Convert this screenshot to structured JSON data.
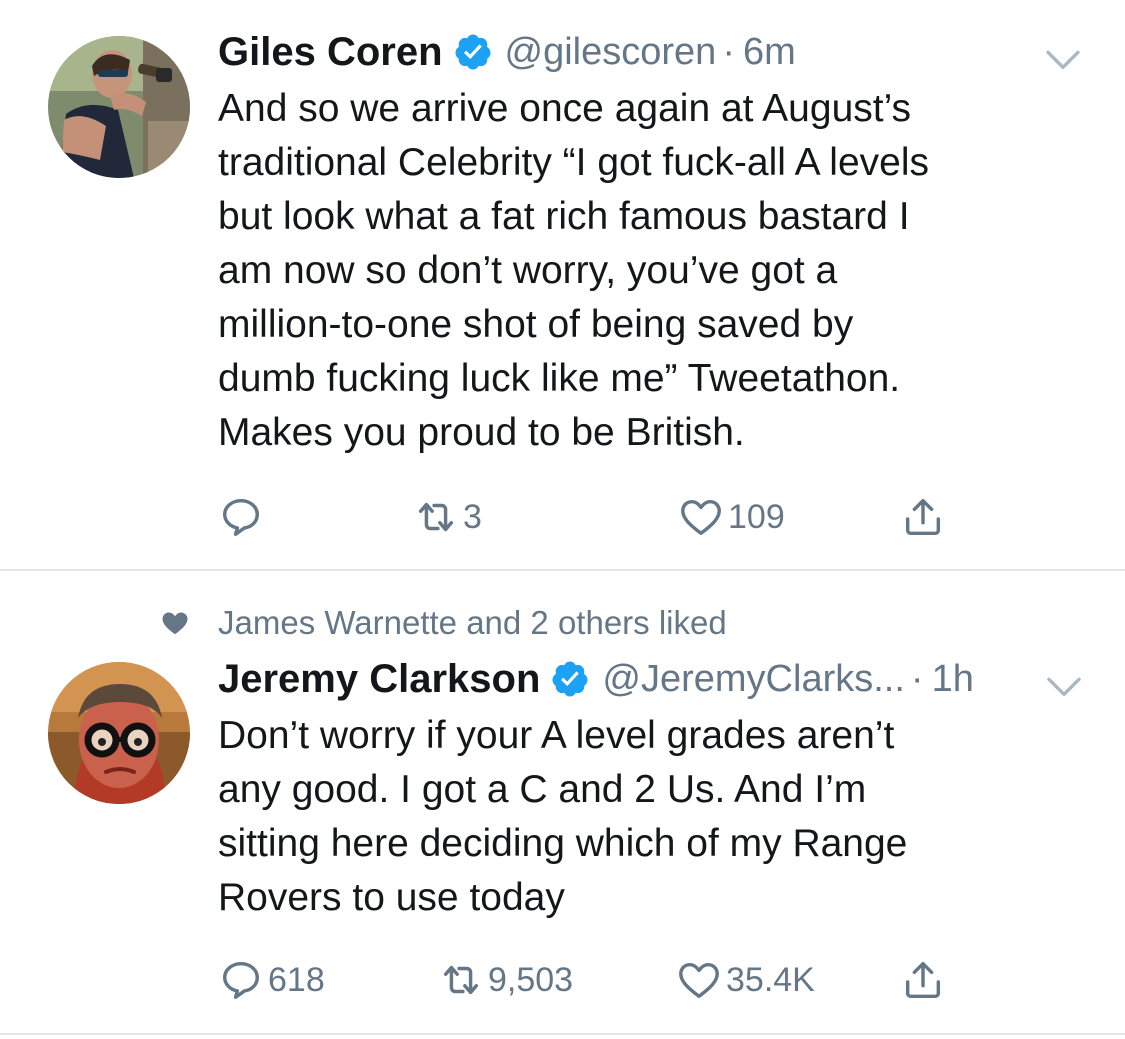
{
  "tweets": [
    {
      "display_name": "Giles Coren",
      "handle": "@gilescoren",
      "separator": "·",
      "time": "6m",
      "verified": true,
      "text_lines": [
        "And so we arrive once again at August’s",
        "traditional Celebrity “I got fuck-all A levels",
        "but look what a fat rich famous bastard I",
        "am now so don’t worry, you’ve got a",
        "million-to-one shot of being saved by",
        "dumb fucking luck like me” Tweetathon.",
        "Makes you proud to be British."
      ],
      "reply_count": "",
      "retweet_count": "3",
      "like_count": "109"
    },
    {
      "social_context": "James Warnette and 2 others liked",
      "display_name": "Jeremy Clarkson",
      "handle": "@JeremyClarks...",
      "separator": "·",
      "time": "1h",
      "verified": true,
      "text_lines": [
        "Don’t worry if your A level grades aren’t",
        "any good. I got a C and 2 Us. And I’m",
        "sitting here deciding which of my Range",
        "Rovers to use today"
      ],
      "reply_count": "618",
      "retweet_count": "9,503",
      "like_count": "35.4K"
    }
  ],
  "icons": {
    "verified": "verified-badge-icon",
    "caret": "chevron-down-icon",
    "reply": "reply-icon",
    "retweet": "retweet-icon",
    "like": "heart-icon",
    "share": "share-icon",
    "liked_context": "heart-filled-icon"
  },
  "colors": {
    "text": "#14171a",
    "secondary": "#657786",
    "verified": "#1da1f2",
    "divider": "#e1e8ed"
  }
}
